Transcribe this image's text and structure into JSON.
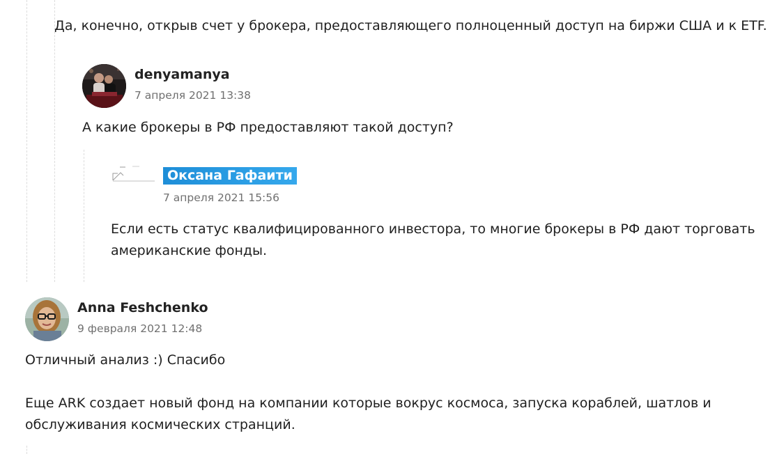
{
  "thread": {
    "previous_reply": {
      "text": "Да, конечно, открыв счет у брокера, предоставляющего полноценный доступ на биржи США и к ETF."
    },
    "reply1": {
      "author": "denyamanya",
      "date": "7 апреля 2021 13:38",
      "text": "А какие брокеры в РФ предоставляют такой доступ?"
    },
    "reply2": {
      "author": "Оксана Гафаити",
      "date": "7 апреля 2021 15:56",
      "text_line1": "Если есть статус квалифицированного инвестора, то многие брокеры в РФ дают торговать",
      "text_line2": "американские фонды."
    }
  },
  "comment": {
    "author": "Anna Feshchenko",
    "date": "9 февраля 2021 12:48",
    "para1": "Отличный анализ :) Спасибо",
    "para2_line1": "Еще ARK создает новый фонд на компании которые вокрус космоса, запуска кораблей, шатлов и",
    "para2_line2": "обслуживания космических странций."
  },
  "colors": {
    "author_highlight": "#1e8ed8",
    "date": "#707070",
    "thread_line": "#dcdcdc"
  }
}
